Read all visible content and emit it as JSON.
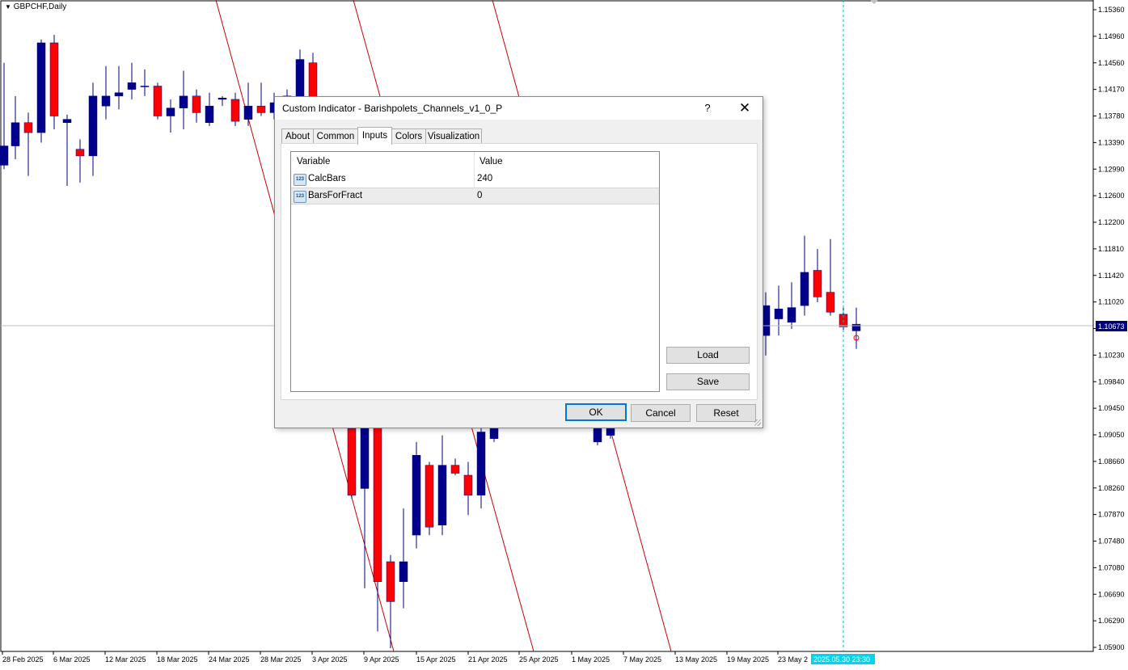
{
  "chart": {
    "symbol": "GBPCHF,Daily",
    "y_ticks": [
      "1.15360",
      "1.14960",
      "1.14560",
      "1.14170",
      "1.13780",
      "1.13390",
      "1.12990",
      "1.12600",
      "1.12200",
      "1.11810",
      "1.11420",
      "1.11020",
      "1.10630",
      "1.10230",
      "1.09840",
      "1.09450",
      "1.09050",
      "1.08660",
      "1.08260",
      "1.07870",
      "1.07480",
      "1.07080",
      "1.06690",
      "1.06290",
      "1.05900"
    ],
    "x_ticks": [
      "28 Feb 2025",
      "6 Mar 2025",
      "12 Mar 2025",
      "18 Mar 2025",
      "24 Mar 2025",
      "28 Mar 2025",
      "3 Apr 2025",
      "9 Apr 2025",
      "15 Apr 2025",
      "21 Apr 2025",
      "25 Apr 2025",
      "1 May 2025",
      "7 May 2025",
      "13 May 2025",
      "19 May 2025",
      "23 May 2"
    ],
    "current_price": "1.10673",
    "crosshair_time": "2025.05.30 23:30",
    "colors": {
      "bull": "#00008b",
      "bear": "#ff0000",
      "channel": "#cc0000",
      "crosshair": "#00b4d8",
      "price_tag_bg": "#000080"
    }
  },
  "chart_data": {
    "type": "candlestick",
    "title": "GBPCHF,Daily",
    "ylim": [
      1.059,
      1.1551
    ],
    "candles": [
      {
        "x": 5,
        "o": 1.1316,
        "h": 1.147,
        "l": 1.131,
        "c": 1.1345
      },
      {
        "x": 19,
        "o": 1.1345,
        "h": 1.142,
        "l": 1.1325,
        "c": 1.138
      },
      {
        "x": 35,
        "o": 1.138,
        "h": 1.1395,
        "l": 1.13,
        "c": 1.1365
      },
      {
        "x": 51,
        "o": 1.1365,
        "h": 1.1505,
        "l": 1.135,
        "c": 1.15
      },
      {
        "x": 67,
        "o": 1.15,
        "h": 1.1512,
        "l": 1.137,
        "c": 1.139
      },
      {
        "x": 83,
        "o": 1.138,
        "h": 1.1392,
        "l": 1.1285,
        "c": 1.1385
      },
      {
        "x": 99,
        "o": 1.134,
        "h": 1.1355,
        "l": 1.129,
        "c": 1.133
      },
      {
        "x": 115,
        "o": 1.133,
        "h": 1.144,
        "l": 1.13,
        "c": 1.142
      },
      {
        "x": 131,
        "o": 1.1405,
        "h": 1.1465,
        "l": 1.1385,
        "c": 1.142
      },
      {
        "x": 147,
        "o": 1.142,
        "h": 1.1465,
        "l": 1.14,
        "c": 1.1425
      },
      {
        "x": 163,
        "o": 1.143,
        "h": 1.147,
        "l": 1.1415,
        "c": 1.144
      },
      {
        "x": 179,
        "o": 1.1434,
        "h": 1.146,
        "l": 1.142,
        "c": 1.1435
      },
      {
        "x": 195,
        "o": 1.1435,
        "h": 1.144,
        "l": 1.1385,
        "c": 1.139
      },
      {
        "x": 211,
        "o": 1.139,
        "h": 1.1415,
        "l": 1.1365,
        "c": 1.1402
      },
      {
        "x": 227,
        "o": 1.1402,
        "h": 1.1458,
        "l": 1.137,
        "c": 1.142
      },
      {
        "x": 243,
        "o": 1.142,
        "h": 1.143,
        "l": 1.138,
        "c": 1.1395
      },
      {
        "x": 259,
        "o": 1.138,
        "h": 1.1425,
        "l": 1.1375,
        "c": 1.1405
      },
      {
        "x": 275,
        "o": 1.1415,
        "h": 1.142,
        "l": 1.1405,
        "c": 1.1417
      },
      {
        "x": 291,
        "o": 1.1415,
        "h": 1.1425,
        "l": 1.1375,
        "c": 1.1382
      },
      {
        "x": 307,
        "o": 1.1385,
        "h": 1.144,
        "l": 1.1375,
        "c": 1.1405
      },
      {
        "x": 323,
        "o": 1.1405,
        "h": 1.144,
        "l": 1.139,
        "c": 1.1395
      },
      {
        "x": 339,
        "o": 1.1395,
        "h": 1.1425,
        "l": 1.1385,
        "c": 1.141
      },
      {
        "x": 355,
        "o": 1.142,
        "h": 1.143,
        "l": 1.141,
        "c": 1.1415
      },
      {
        "x": 371,
        "o": 1.141,
        "h": 1.149,
        "l": 1.1395,
        "c": 1.1475
      },
      {
        "x": 387,
        "o": 1.147,
        "h": 1.1485,
        "l": 1.138,
        "c": 1.1395
      },
      {
        "x": 435,
        "o": 1.092,
        "h": 1.093,
        "l": 1.0815,
        "c": 1.082
      },
      {
        "x": 451,
        "o": 1.083,
        "h": 1.093,
        "l": 1.068,
        "c": 1.0925
      },
      {
        "x": 467,
        "o": 1.0925,
        "h": 1.0935,
        "l": 1.0615,
        "c": 1.069
      },
      {
        "x": 483,
        "o": 1.072,
        "h": 1.073,
        "l": 1.059,
        "c": 1.066
      },
      {
        "x": 499,
        "o": 1.069,
        "h": 1.08,
        "l": 1.065,
        "c": 1.072
      },
      {
        "x": 515,
        "o": 1.076,
        "h": 1.09,
        "l": 1.074,
        "c": 1.088
      },
      {
        "x": 531,
        "o": 1.0865,
        "h": 1.087,
        "l": 1.076,
        "c": 1.0772
      },
      {
        "x": 547,
        "o": 1.0775,
        "h": 1.091,
        "l": 1.076,
        "c": 1.0865
      },
      {
        "x": 563,
        "o": 1.0865,
        "h": 1.0875,
        "l": 1.085,
        "c": 1.0853
      },
      {
        "x": 579,
        "o": 1.085,
        "h": 1.087,
        "l": 1.079,
        "c": 1.082
      },
      {
        "x": 595,
        "o": 1.082,
        "h": 1.0925,
        "l": 1.08,
        "c": 1.0915
      },
      {
        "x": 611,
        "o": 1.0905,
        "h": 1.0925,
        "l": 1.09,
        "c": 1.092
      },
      {
        "x": 739,
        "o": 1.09,
        "h": 1.0925,
        "l": 1.0895,
        "c": 1.092
      },
      {
        "x": 755,
        "o": 1.091,
        "h": 1.0925,
        "l": 1.0905,
        "c": 1.092
      },
      {
        "x": 947,
        "o": 1.106,
        "h": 1.1125,
        "l": 1.103,
        "c": 1.1105
      },
      {
        "x": 963,
        "o": 1.1085,
        "h": 1.1135,
        "l": 1.106,
        "c": 1.11
      },
      {
        "x": 979,
        "o": 1.108,
        "h": 1.114,
        "l": 1.107,
        "c": 1.1102
      },
      {
        "x": 995,
        "o": 1.1105,
        "h": 1.121,
        "l": 1.109,
        "c": 1.1155
      },
      {
        "x": 1011,
        "o": 1.1158,
        "h": 1.119,
        "l": 1.111,
        "c": 1.1118
      },
      {
        "x": 1027,
        "o": 1.1125,
        "h": 1.1205,
        "l": 1.109,
        "c": 1.1095
      },
      {
        "x": 1043,
        "o": 1.1092,
        "h": 1.1105,
        "l": 1.1065,
        "c": 1.1073
      },
      {
        "x": 1059,
        "o": 1.1067,
        "h": 1.1102,
        "l": 1.104,
        "c": 1.1077
      }
    ]
  },
  "dialog": {
    "title": "Custom Indicator - Barishpolets_Channels_v1_0_P",
    "help_label": "?",
    "close_label": "✕",
    "tabs": [
      "About",
      "Common",
      "Inputs",
      "Colors",
      "Visualization"
    ],
    "active_tab": "Inputs",
    "columns": {
      "variable": "Variable",
      "value": "Value"
    },
    "params": [
      {
        "icon": "123",
        "name": "CalcBars",
        "value": "240"
      },
      {
        "icon": "123",
        "name": "BarsForFract",
        "value": "0"
      }
    ],
    "side_buttons": {
      "load": "Load",
      "save": "Save"
    },
    "buttons": {
      "ok": "OK",
      "cancel": "Cancel",
      "reset": "Reset"
    }
  }
}
